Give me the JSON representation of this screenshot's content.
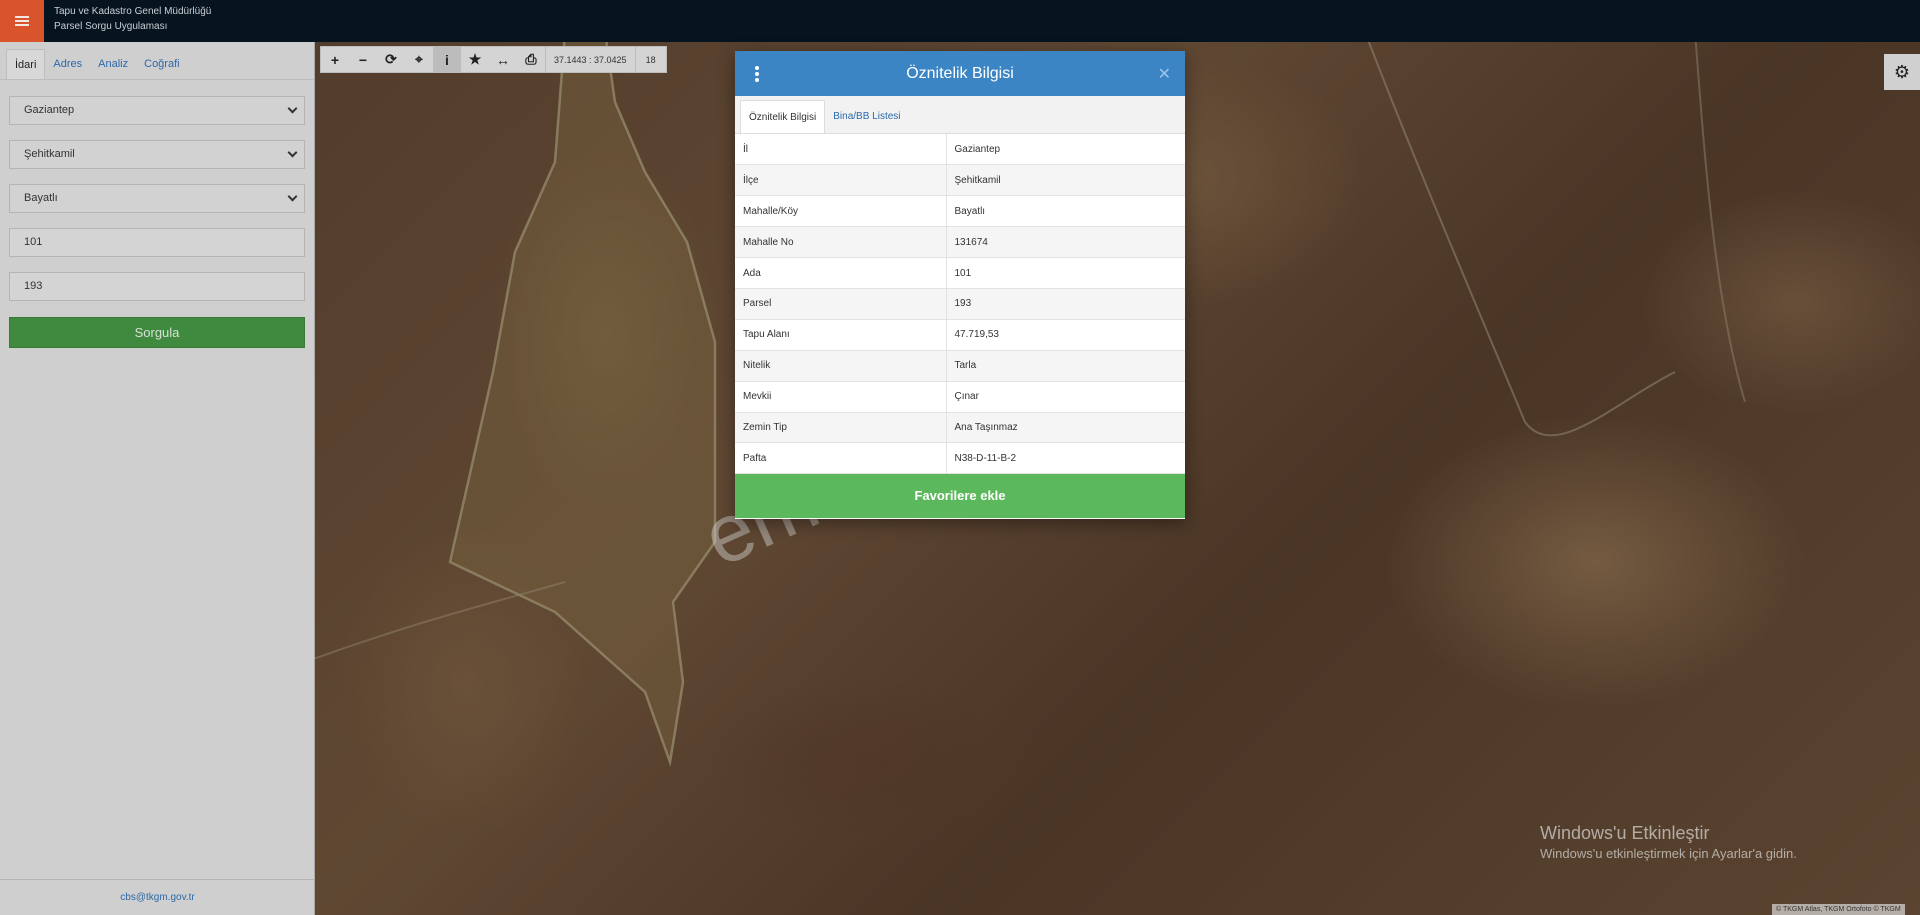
{
  "header": {
    "menu_icon": "hamburger-menu-icon",
    "title_line1": "Tapu ve Kadastro Genel Müdürlüğü",
    "title_line2": "Parsel Sorgu Uygulaması",
    "colors": {
      "bar": "#06141f",
      "menu": "#d9542b"
    }
  },
  "sidebar": {
    "tabs": [
      "İdari",
      "Adres",
      "Analiz",
      "Coğrafi"
    ],
    "active_tab": "İdari",
    "il": "Gaziantep",
    "ilce": "Şehitkamil",
    "mahalle": "Bayatlı",
    "ada": "101",
    "parsel": "193",
    "query_label": "Sorgula",
    "footer_email": "cbs@tkgm.gov.tr"
  },
  "map": {
    "toolbar_icons": [
      "zoom-in-icon",
      "zoom-out-icon",
      "refresh-icon",
      "locate-icon",
      "info-icon",
      "favorite-star-icon",
      "measure-icon",
      "print-icon"
    ],
    "coords": "37.1443 : 37.0425",
    "zoom_level": "18",
    "settings_icon": "gear-icon",
    "watermark": "emlakjet.com",
    "attribution": "© TKGM Atlas, TKGM Ortofoto © TKGM"
  },
  "windows_notice": {
    "line1": "Windows'u Etkinleştir",
    "line2": "Windows'u etkinleştirmek için Ayarlar'a gidin."
  },
  "modal": {
    "title": "Öznitelik Bilgisi",
    "tabs": [
      "Öznitelik Bilgisi",
      "Bina/BB Listesi"
    ],
    "active_tab": "Öznitelik Bilgisi",
    "rows": [
      {
        "key": "İl",
        "value": "Gaziantep"
      },
      {
        "key": "İlçe",
        "value": "Şehitkamil"
      },
      {
        "key": "Mahalle/Köy",
        "value": "Bayatlı"
      },
      {
        "key": "Mahalle No",
        "value": "131674"
      },
      {
        "key": "Ada",
        "value": "101"
      },
      {
        "key": "Parsel",
        "value": "193"
      },
      {
        "key": "Tapu Alanı",
        "value": "47.719,53"
      },
      {
        "key": "Nitelik",
        "value": "Tarla"
      },
      {
        "key": "Mevkii",
        "value": "Çınar"
      },
      {
        "key": "Zemin Tip",
        "value": "Ana Taşınmaz"
      },
      {
        "key": "Pafta",
        "value": "N38-D-11-B-2"
      }
    ],
    "favorite_label": "Favorilere ekle",
    "colors": {
      "header": "#3c85c4",
      "favorite": "#5cb85c"
    }
  }
}
